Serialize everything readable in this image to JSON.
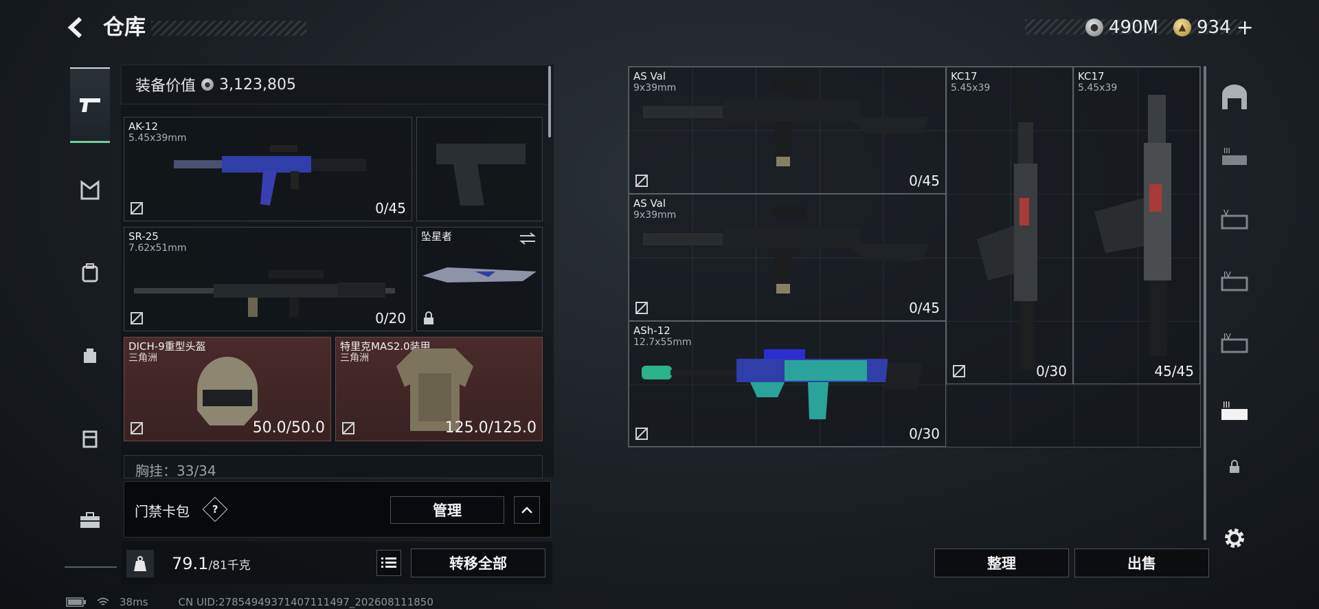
{
  "header": {
    "title": "仓库",
    "currency_silver": "490M",
    "currency_gold": "934",
    "plus": "+"
  },
  "equipment_value": {
    "label": "装备价值",
    "value": "3,123,805"
  },
  "loadout": [
    {
      "name": "AK-12",
      "sub": "5.45x39mm",
      "count": "0/45"
    },
    {
      "name": "SR-25",
      "sub": "7.62x51mm",
      "count": "0/20"
    },
    {
      "name": "坠星者",
      "sub": "",
      "count": ""
    },
    {
      "name": "DICH-9重型头盔",
      "sub": "三角洲",
      "count": "50.0/50.0"
    },
    {
      "name": "特里克MAS2.0装甲",
      "sub": "三角洲",
      "count": "125.0/125.0"
    }
  ],
  "chest_rig_partial": "胸挂：33/34",
  "card_pack": {
    "label": "门禁卡包",
    "help": "?",
    "manage": "管理"
  },
  "weight": {
    "value": "79.1",
    "max": "/81千克"
  },
  "buttons": {
    "transfer_all": "转移全部",
    "sort": "整理",
    "sell": "出售"
  },
  "storage": [
    {
      "name": "AS Val",
      "sub": "9x39mm",
      "count": "0/45"
    },
    {
      "name": "AS Val",
      "sub": "9x39mm",
      "count": "0/45"
    },
    {
      "name": "ASh-12",
      "sub": "12.7x55mm",
      "count": "0/30"
    },
    {
      "name": "KC17",
      "sub": "5.45x39",
      "count": "0/30"
    },
    {
      "name": "KC17",
      "sub": "5.45x39",
      "count": "45/45"
    }
  ],
  "status": {
    "ping": "38ms",
    "uid": "CN UID:27854949371407111497_202608111850"
  },
  "colors": {
    "accent": "#6bd39a",
    "armor_bg": "#4a2a2a"
  }
}
